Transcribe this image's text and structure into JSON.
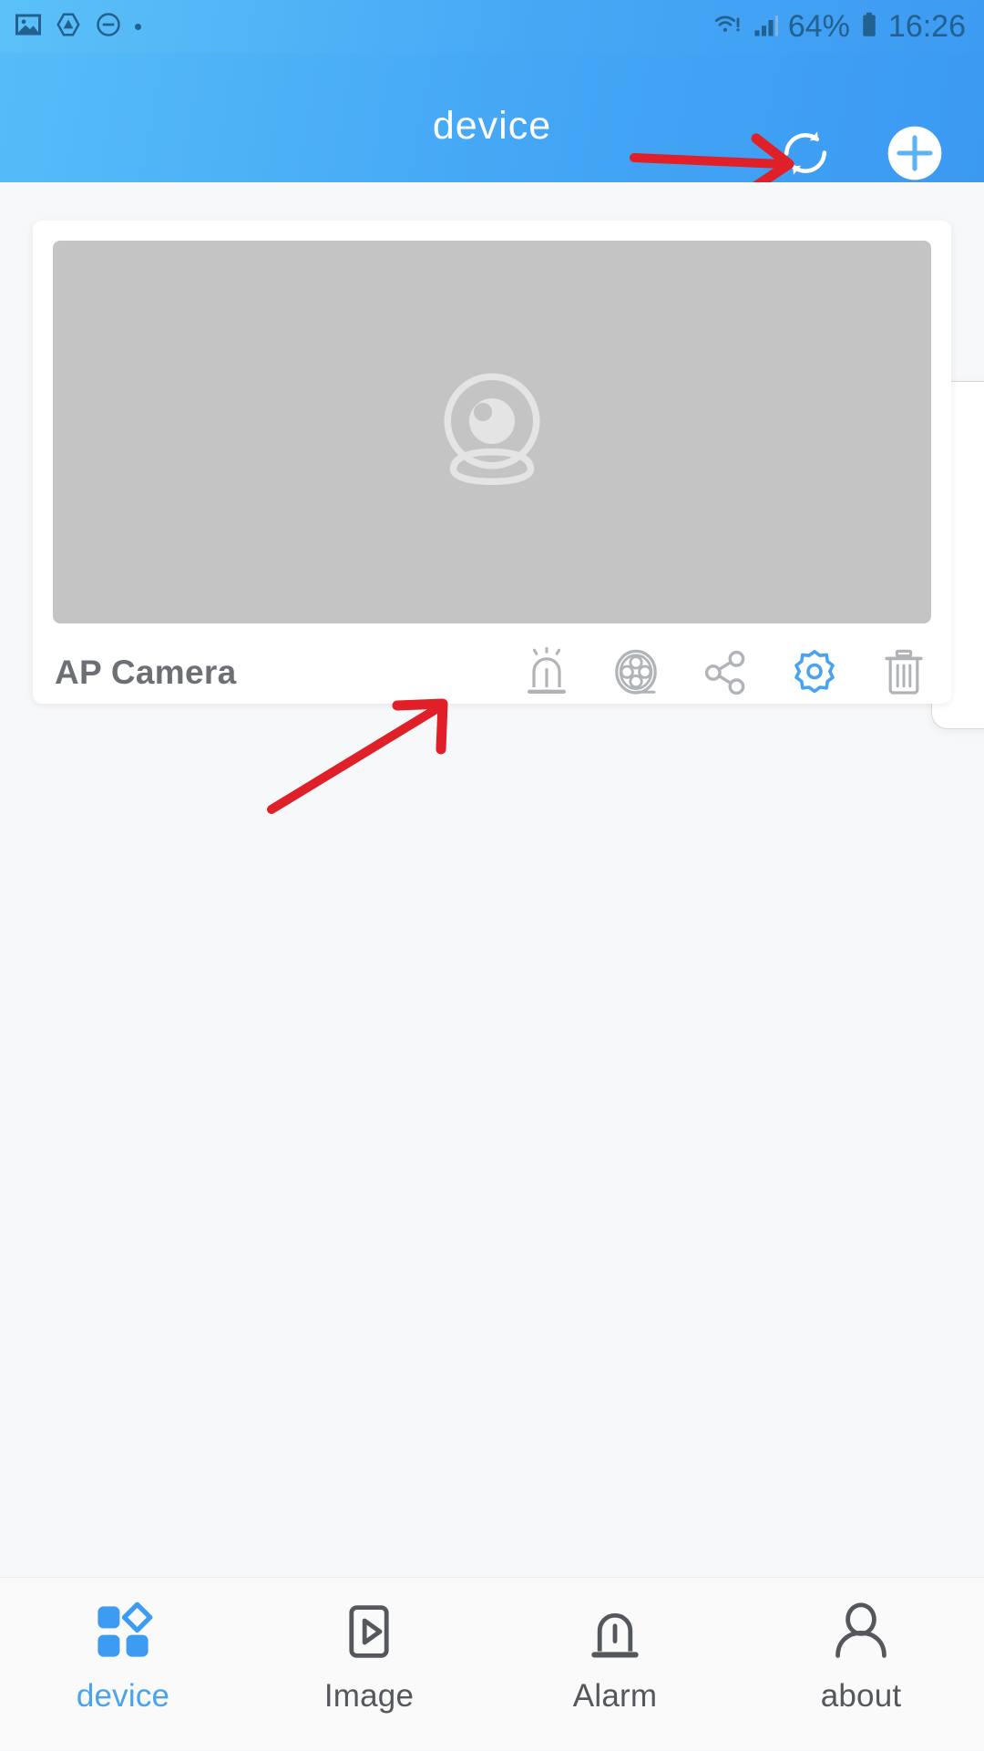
{
  "status_bar": {
    "left_icons": [
      "image-icon",
      "affinity-triangle-icon",
      "do-not-disturb-icon",
      "dot-indicator"
    ],
    "wifi_icon": "wifi-warning-icon",
    "signal_icon": "signal-bars-icon",
    "battery_percent": "64%",
    "battery_icon": "battery-icon",
    "time": "16:26",
    "text_color": "#21608f"
  },
  "app_bar": {
    "title": "device",
    "refresh_icon": "refresh-icon",
    "add_icon": "plus-circle-icon",
    "background_start": "#56bcf8",
    "background_end": "#3b99f2"
  },
  "annotations": {
    "arrow_color": "#e02028",
    "arrow_to_refresh": "red-arrow-pointing-right",
    "arrow_to_camera": "red-arrow-pointing-up-right"
  },
  "device_card": {
    "name": "AP Camera",
    "preview_placeholder_icon": "webcam-placeholder-icon",
    "preview_background": "#c4c4c4",
    "actions": [
      {
        "name": "alarm",
        "icon": "siren-alarm-icon",
        "color": "#b0b3b8",
        "active": false
      },
      {
        "name": "playback",
        "icon": "film-reel-icon",
        "color": "#b0b3b8",
        "active": false
      },
      {
        "name": "share",
        "icon": "share-nodes-icon",
        "color": "#b0b3b8",
        "active": false
      },
      {
        "name": "settings",
        "icon": "gear-icon",
        "color": "#4aa3ef",
        "active": true
      },
      {
        "name": "delete",
        "icon": "trash-icon",
        "color": "#b0b3b8",
        "active": false
      }
    ]
  },
  "side_drawer": {
    "visible_edge": true
  },
  "bottom_nav": {
    "active_color": "#4aa3ef",
    "inactive_color": "#54575c",
    "items": [
      {
        "label": "device",
        "icon": "grid-blocks-icon",
        "active": true
      },
      {
        "label": "Image",
        "icon": "play-rect-icon",
        "active": false
      },
      {
        "label": "Alarm",
        "icon": "siren-alarm-icon",
        "active": false
      },
      {
        "label": "about",
        "icon": "person-icon",
        "active": false
      }
    ]
  }
}
